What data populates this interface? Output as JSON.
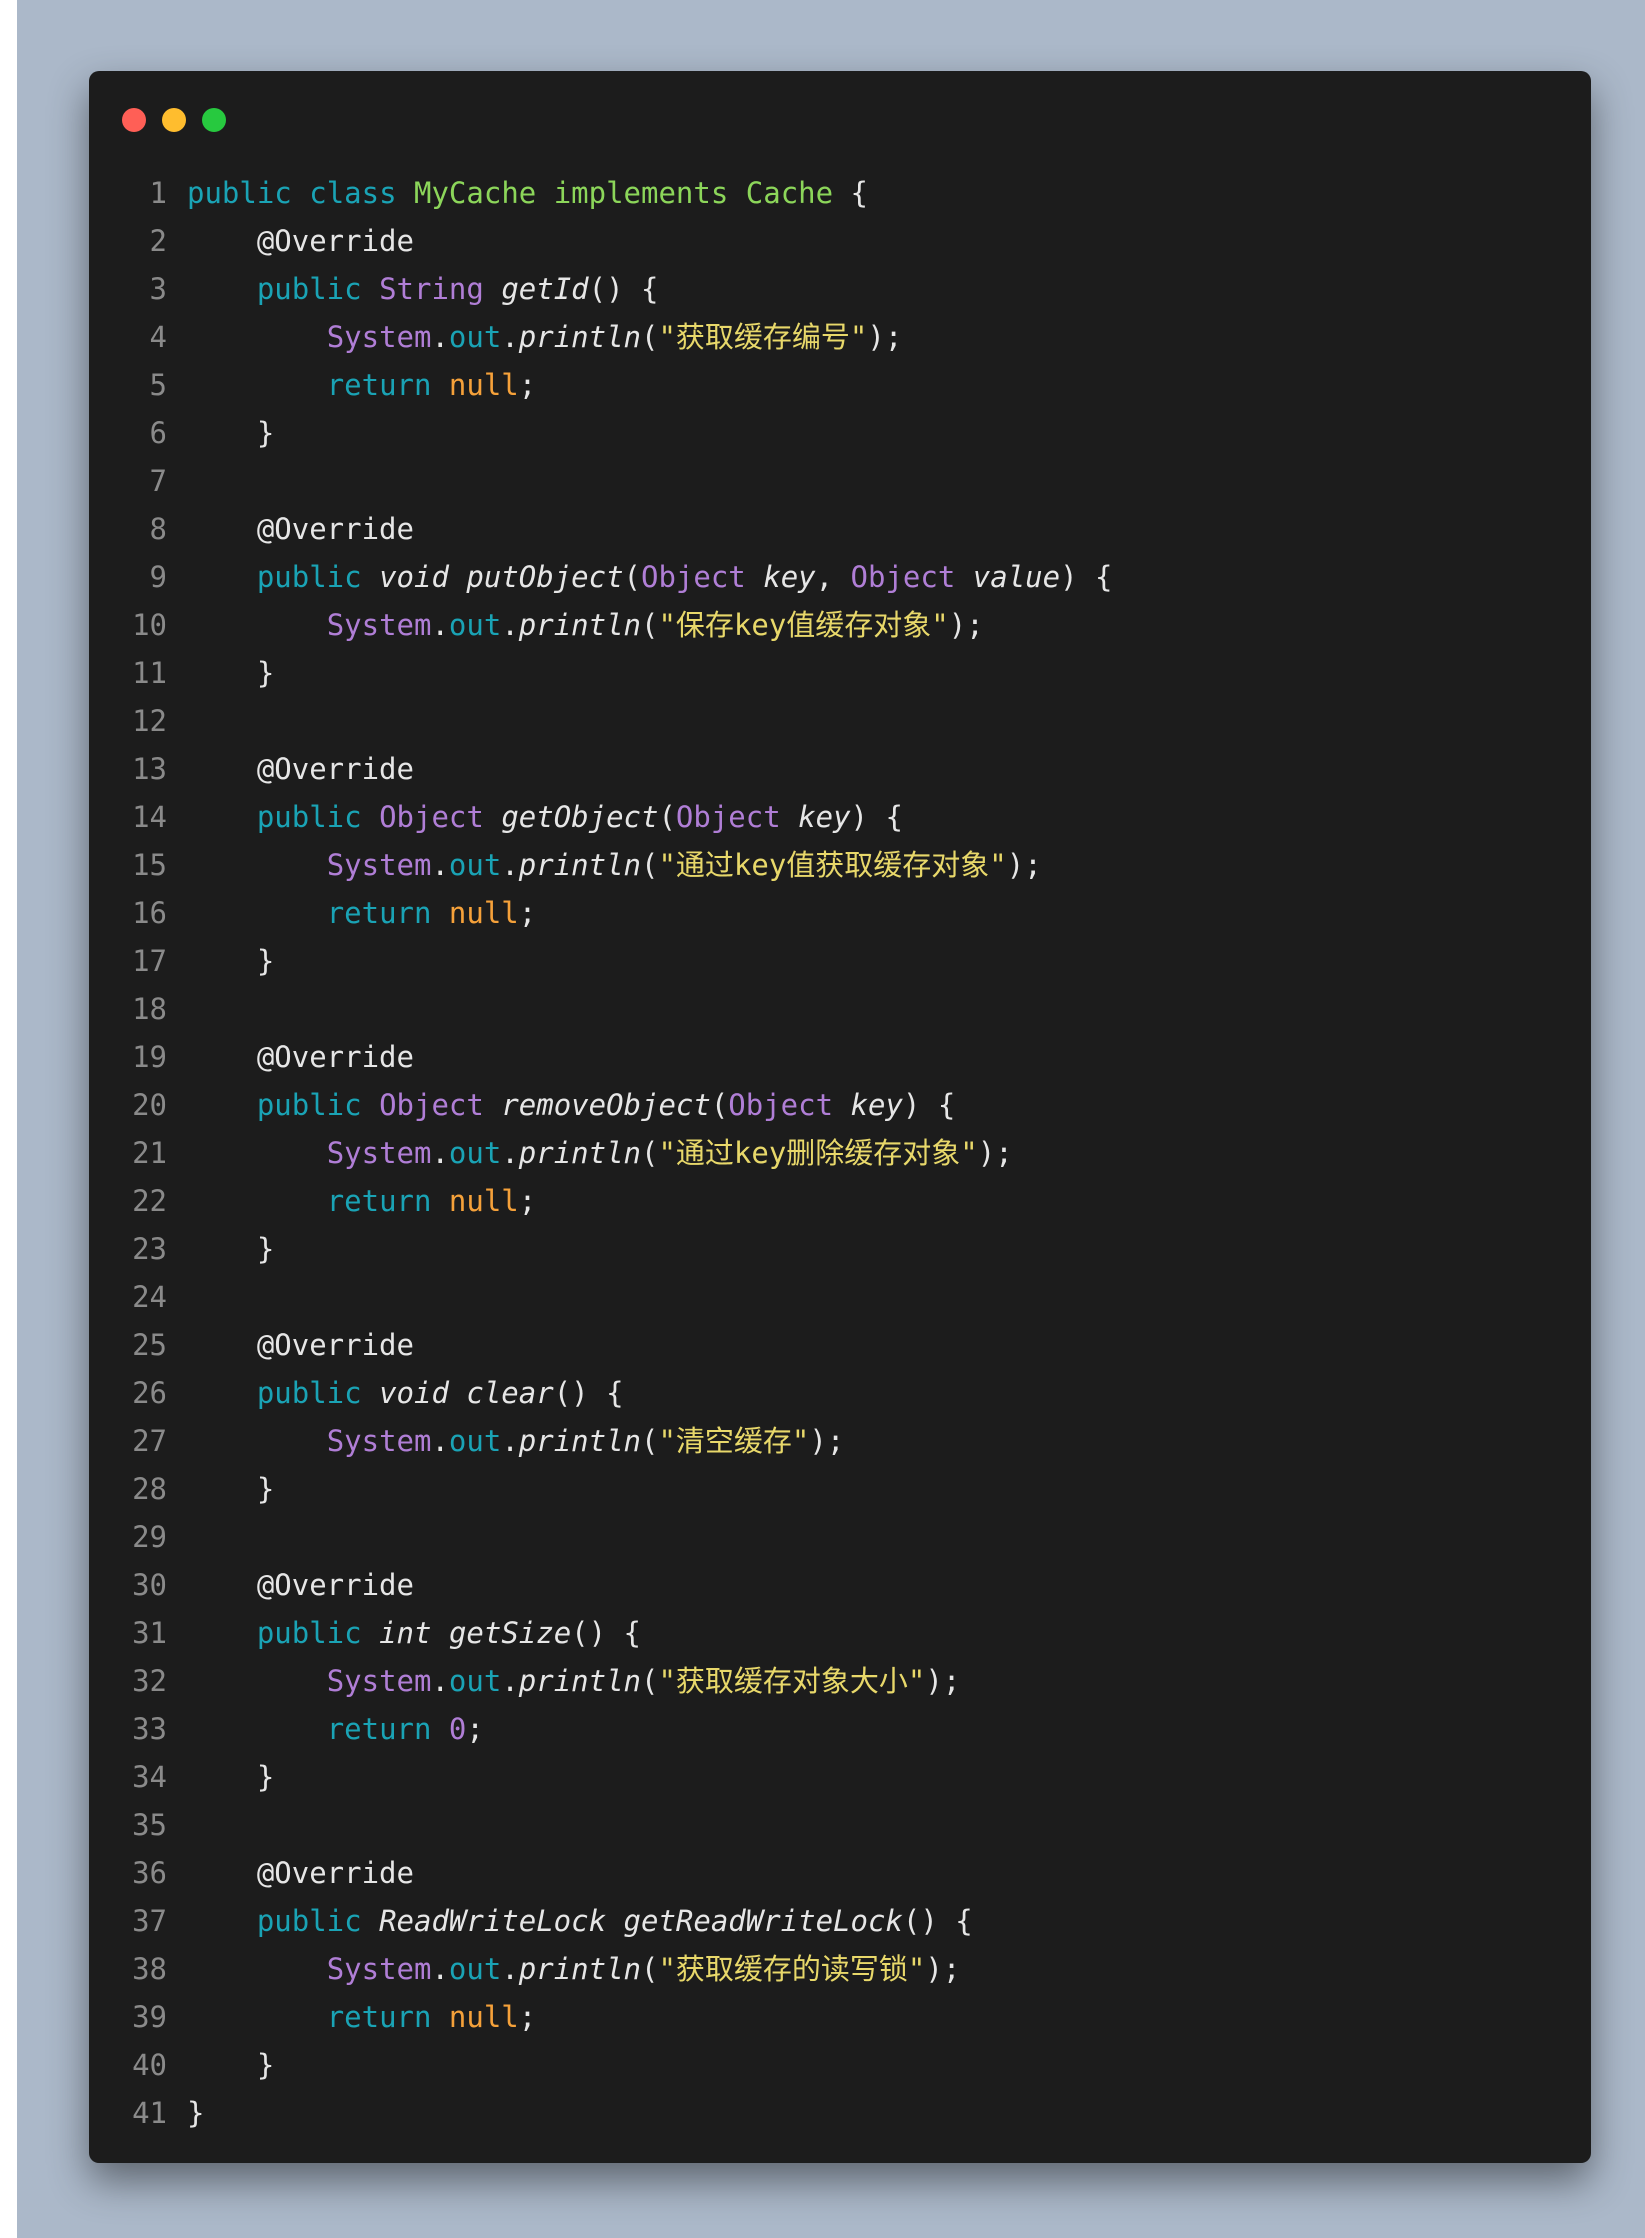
{
  "colors": {
    "page_background": "#abb8c9",
    "window_background": "#1c1c1c",
    "dot_red": "#ff5f56",
    "dot_yellow": "#ffbd2e",
    "dot_green": "#27c93f",
    "line_number": "#8a8a8a",
    "keyword": "#1aa3b5",
    "class_name": "#8cd65a",
    "type": "#b07ed6",
    "string": "#e8d86a",
    "literal": "#f5a13a"
  },
  "icons": [
    "close-dot-icon",
    "minimize-dot-icon",
    "maximize-dot-icon"
  ],
  "lines": [
    {
      "n": "1",
      "indent": "",
      "tokens": [
        [
          "public",
          "kw"
        ],
        [
          " ",
          ""
        ],
        [
          "class",
          "kw"
        ],
        [
          " ",
          ""
        ],
        [
          "MyCache",
          "cls"
        ],
        [
          " ",
          ""
        ],
        [
          "implements",
          "cls"
        ],
        [
          " ",
          ""
        ],
        [
          "Cache",
          "cls"
        ],
        [
          " {",
          ""
        ]
      ]
    },
    {
      "n": "2",
      "indent": "    ",
      "tokens": [
        [
          "@Override",
          "ann"
        ]
      ]
    },
    {
      "n": "3",
      "indent": "    ",
      "tokens": [
        [
          "public",
          "kw"
        ],
        [
          " ",
          ""
        ],
        [
          "String",
          "typ"
        ],
        [
          " ",
          ""
        ],
        [
          "getId",
          "it"
        ],
        [
          "() {",
          ""
        ]
      ]
    },
    {
      "n": "4",
      "indent": "        ",
      "tokens": [
        [
          "System",
          "typ"
        ],
        [
          ".",
          ""
        ],
        [
          "out",
          "fld"
        ],
        [
          ".",
          ""
        ],
        [
          "println",
          "it"
        ],
        [
          "(",
          ""
        ],
        [
          "\"获取缓存编号\"",
          "str"
        ],
        [
          ");",
          ""
        ]
      ]
    },
    {
      "n": "5",
      "indent": "        ",
      "tokens": [
        [
          "return",
          "kw"
        ],
        [
          " ",
          ""
        ],
        [
          "null",
          "lit"
        ],
        [
          ";",
          ""
        ]
      ]
    },
    {
      "n": "6",
      "indent": "    ",
      "tokens": [
        [
          "}",
          ""
        ]
      ]
    },
    {
      "n": "7",
      "indent": "",
      "tokens": []
    },
    {
      "n": "8",
      "indent": "    ",
      "tokens": [
        [
          "@Override",
          "ann"
        ]
      ]
    },
    {
      "n": "9",
      "indent": "    ",
      "tokens": [
        [
          "public",
          "kw"
        ],
        [
          " ",
          ""
        ],
        [
          "void",
          "it"
        ],
        [
          " ",
          ""
        ],
        [
          "putObject",
          "it"
        ],
        [
          "(",
          ""
        ],
        [
          "Object",
          "typ"
        ],
        [
          " ",
          ""
        ],
        [
          "key",
          "it"
        ],
        [
          ", ",
          ""
        ],
        [
          "Object",
          "typ"
        ],
        [
          " ",
          ""
        ],
        [
          "value",
          "it"
        ],
        [
          ") {",
          ""
        ]
      ]
    },
    {
      "n": "10",
      "indent": "        ",
      "tokens": [
        [
          "System",
          "typ"
        ],
        [
          ".",
          ""
        ],
        [
          "out",
          "fld"
        ],
        [
          ".",
          ""
        ],
        [
          "println",
          "it"
        ],
        [
          "(",
          ""
        ],
        [
          "\"保存key值缓存对象\"",
          "str"
        ],
        [
          ");",
          ""
        ]
      ]
    },
    {
      "n": "11",
      "indent": "    ",
      "tokens": [
        [
          "}",
          ""
        ]
      ]
    },
    {
      "n": "12",
      "indent": "",
      "tokens": []
    },
    {
      "n": "13",
      "indent": "    ",
      "tokens": [
        [
          "@Override",
          "ann"
        ]
      ]
    },
    {
      "n": "14",
      "indent": "    ",
      "tokens": [
        [
          "public",
          "kw"
        ],
        [
          " ",
          ""
        ],
        [
          "Object",
          "typ"
        ],
        [
          " ",
          ""
        ],
        [
          "getObject",
          "it"
        ],
        [
          "(",
          ""
        ],
        [
          "Object",
          "typ"
        ],
        [
          " ",
          ""
        ],
        [
          "key",
          "it"
        ],
        [
          ") {",
          ""
        ]
      ]
    },
    {
      "n": "15",
      "indent": "        ",
      "tokens": [
        [
          "System",
          "typ"
        ],
        [
          ".",
          ""
        ],
        [
          "out",
          "fld"
        ],
        [
          ".",
          ""
        ],
        [
          "println",
          "it"
        ],
        [
          "(",
          ""
        ],
        [
          "\"通过key值获取缓存对象\"",
          "str"
        ],
        [
          ");",
          ""
        ]
      ]
    },
    {
      "n": "16",
      "indent": "        ",
      "tokens": [
        [
          "return",
          "kw"
        ],
        [
          " ",
          ""
        ],
        [
          "null",
          "lit"
        ],
        [
          ";",
          ""
        ]
      ]
    },
    {
      "n": "17",
      "indent": "    ",
      "tokens": [
        [
          "}",
          ""
        ]
      ]
    },
    {
      "n": "18",
      "indent": "",
      "tokens": []
    },
    {
      "n": "19",
      "indent": "    ",
      "tokens": [
        [
          "@Override",
          "ann"
        ]
      ]
    },
    {
      "n": "20",
      "indent": "    ",
      "tokens": [
        [
          "public",
          "kw"
        ],
        [
          " ",
          ""
        ],
        [
          "Object",
          "typ"
        ],
        [
          " ",
          ""
        ],
        [
          "removeObject",
          "it"
        ],
        [
          "(",
          ""
        ],
        [
          "Object",
          "typ"
        ],
        [
          " ",
          ""
        ],
        [
          "key",
          "it"
        ],
        [
          ") {",
          ""
        ]
      ]
    },
    {
      "n": "21",
      "indent": "        ",
      "tokens": [
        [
          "System",
          "typ"
        ],
        [
          ".",
          ""
        ],
        [
          "out",
          "fld"
        ],
        [
          ".",
          ""
        ],
        [
          "println",
          "it"
        ],
        [
          "(",
          ""
        ],
        [
          "\"通过key删除缓存对象\"",
          "str"
        ],
        [
          ");",
          ""
        ]
      ]
    },
    {
      "n": "22",
      "indent": "        ",
      "tokens": [
        [
          "return",
          "kw"
        ],
        [
          " ",
          ""
        ],
        [
          "null",
          "lit"
        ],
        [
          ";",
          ""
        ]
      ]
    },
    {
      "n": "23",
      "indent": "    ",
      "tokens": [
        [
          "}",
          ""
        ]
      ]
    },
    {
      "n": "24",
      "indent": "",
      "tokens": []
    },
    {
      "n": "25",
      "indent": "    ",
      "tokens": [
        [
          "@Override",
          "ann"
        ]
      ]
    },
    {
      "n": "26",
      "indent": "    ",
      "tokens": [
        [
          "public",
          "kw"
        ],
        [
          " ",
          ""
        ],
        [
          "void",
          "it"
        ],
        [
          " ",
          ""
        ],
        [
          "clear",
          "it"
        ],
        [
          "() {",
          ""
        ]
      ]
    },
    {
      "n": "27",
      "indent": "        ",
      "tokens": [
        [
          "System",
          "typ"
        ],
        [
          ".",
          ""
        ],
        [
          "out",
          "fld"
        ],
        [
          ".",
          ""
        ],
        [
          "println",
          "it"
        ],
        [
          "(",
          ""
        ],
        [
          "\"清空缓存\"",
          "str"
        ],
        [
          ");",
          ""
        ]
      ]
    },
    {
      "n": "28",
      "indent": "    ",
      "tokens": [
        [
          "}",
          ""
        ]
      ]
    },
    {
      "n": "29",
      "indent": "",
      "tokens": []
    },
    {
      "n": "30",
      "indent": "    ",
      "tokens": [
        [
          "@Override",
          "ann"
        ]
      ]
    },
    {
      "n": "31",
      "indent": "    ",
      "tokens": [
        [
          "public",
          "kw"
        ],
        [
          " ",
          ""
        ],
        [
          "int",
          "it"
        ],
        [
          " ",
          ""
        ],
        [
          "getSize",
          "it"
        ],
        [
          "() {",
          ""
        ]
      ]
    },
    {
      "n": "32",
      "indent": "        ",
      "tokens": [
        [
          "System",
          "typ"
        ],
        [
          ".",
          ""
        ],
        [
          "out",
          "fld"
        ],
        [
          ".",
          ""
        ],
        [
          "println",
          "it"
        ],
        [
          "(",
          ""
        ],
        [
          "\"获取缓存对象大小\"",
          "str"
        ],
        [
          ");",
          ""
        ]
      ]
    },
    {
      "n": "33",
      "indent": "        ",
      "tokens": [
        [
          "return",
          "kw"
        ],
        [
          " ",
          ""
        ],
        [
          "0",
          "num"
        ],
        [
          ";",
          ""
        ]
      ]
    },
    {
      "n": "34",
      "indent": "    ",
      "tokens": [
        [
          "}",
          ""
        ]
      ]
    },
    {
      "n": "35",
      "indent": "",
      "tokens": []
    },
    {
      "n": "36",
      "indent": "    ",
      "tokens": [
        [
          "@Override",
          "ann"
        ]
      ]
    },
    {
      "n": "37",
      "indent": "    ",
      "tokens": [
        [
          "public",
          "kw"
        ],
        [
          " ",
          ""
        ],
        [
          "ReadWriteLock",
          "it"
        ],
        [
          " ",
          ""
        ],
        [
          "getReadWriteLock",
          "it"
        ],
        [
          "() {",
          ""
        ]
      ]
    },
    {
      "n": "38",
      "indent": "        ",
      "tokens": [
        [
          "System",
          "typ"
        ],
        [
          ".",
          ""
        ],
        [
          "out",
          "fld"
        ],
        [
          ".",
          ""
        ],
        [
          "println",
          "it"
        ],
        [
          "(",
          ""
        ],
        [
          "\"获取缓存的读写锁\"",
          "str"
        ],
        [
          ");",
          ""
        ]
      ]
    },
    {
      "n": "39",
      "indent": "        ",
      "tokens": [
        [
          "return",
          "kw"
        ],
        [
          " ",
          ""
        ],
        [
          "null",
          "lit"
        ],
        [
          ";",
          ""
        ]
      ]
    },
    {
      "n": "40",
      "indent": "    ",
      "tokens": [
        [
          "}",
          ""
        ]
      ]
    },
    {
      "n": "41",
      "indent": "",
      "tokens": [
        [
          "}",
          ""
        ]
      ]
    }
  ]
}
